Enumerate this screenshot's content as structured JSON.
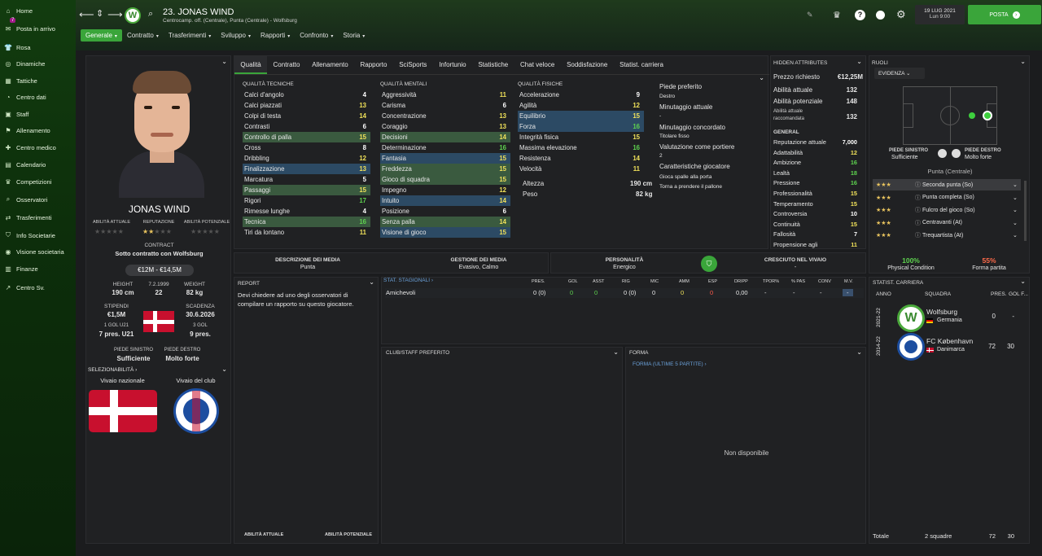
{
  "sidebar": {
    "badge": "7",
    "items": [
      {
        "label": "Home",
        "icon": "home-icon",
        "glyph": "⌂"
      },
      {
        "label": "Posta in arrivo",
        "icon": "inbox-icon",
        "glyph": "✉"
      },
      {
        "label": "Rosa",
        "icon": "squad-icon",
        "glyph": "👕"
      },
      {
        "label": "Dinamiche",
        "icon": "dynamics-icon",
        "glyph": "◎"
      },
      {
        "label": "Tattiche",
        "icon": "tactics-icon",
        "glyph": "▦"
      },
      {
        "label": "Centro dati",
        "icon": "data-icon",
        "glyph": "◔"
      },
      {
        "label": "Staff",
        "icon": "staff-icon",
        "glyph": "▣"
      },
      {
        "label": "Allenamento",
        "icon": "training-icon",
        "glyph": "⚑"
      },
      {
        "label": "Centro medico",
        "icon": "medical-icon",
        "glyph": "✚"
      },
      {
        "label": "Calendario",
        "icon": "calendar-icon",
        "glyph": "▤"
      },
      {
        "label": "Competizioni",
        "icon": "trophy-icon",
        "glyph": "♛"
      },
      {
        "label": "Osservatori",
        "icon": "scout-icon",
        "glyph": "⌕"
      },
      {
        "label": "Trasferimenti",
        "icon": "transfer-icon",
        "glyph": "⇄"
      },
      {
        "label": "Info Societarie",
        "icon": "club-info-icon",
        "glyph": "⛉"
      },
      {
        "label": "Visione societaria",
        "icon": "vision-icon",
        "glyph": "◉"
      },
      {
        "label": "Finanze",
        "icon": "finance-icon",
        "glyph": "▥"
      },
      {
        "label": "Centro Sv.",
        "icon": "dev-centre-icon",
        "glyph": "↗"
      }
    ]
  },
  "header": {
    "title": "23. JONAS WIND",
    "subtitle": "Centrocamp. off. (Centrale), Punta (Centrale) - Wolfsburg",
    "date": "19 LUG 2021",
    "time": "Lun 9:00",
    "posta": "POSTA"
  },
  "tabs": [
    "Generale",
    "Contratto",
    "Trasferimenti",
    "Sviluppo",
    "Rapporti",
    "Confronto",
    "Storia"
  ],
  "subtabs": [
    "Qualità",
    "Contratto",
    "Allenamento",
    "Rapporto",
    "SciSports",
    "Infortunio",
    "Statistiche",
    "Chat veloce",
    "Soddisfazione",
    "Statist. carriera"
  ],
  "profile": {
    "name": "JONAS WIND",
    "lbl_att": "ABILITÀ ATTUALE",
    "lbl_rep": "REPUTAZIONE",
    "lbl_pot": "ABILITÀ POTENZIALE",
    "contract_lbl": "CONTRACT",
    "contract": "Sotto contratto con Wolfsburg",
    "value": "€12M - €14,5M",
    "height_lbl": "HEIGHT",
    "height": "190 cm",
    "dob": "7.2.1999",
    "age": "22",
    "weight_lbl": "WEIGHT",
    "weight": "82 kg",
    "stip_lbl": "STIPENDI",
    "stip": "€1,5M",
    "scad_lbl": "SCADENZA",
    "scad": "30.6.2026",
    "u21_lbl": "1 GOL U21",
    "u21": "7 pres. U21",
    "caps_lbl": "3 GOL",
    "caps": "9 pres.",
    "foot_l_lbl": "PIEDE SINISTRO",
    "foot_l": "Sufficiente",
    "foot_r_lbl": "PIEDE DESTRO",
    "foot_r": "Molto forte",
    "sel_lbl": "SELEZIONABILITÀ",
    "nat_lbl": "Vivaio nazionale",
    "club_lbl": "Vivaio del club"
  },
  "tech": {
    "title": "QUALITÀ TECNICHE",
    "rows": [
      {
        "n": "Calci d'angolo",
        "v": "4",
        "c": "w",
        "h": ""
      },
      {
        "n": "Calci piazzati",
        "v": "13",
        "c": "y",
        "h": ""
      },
      {
        "n": "Colpi di testa",
        "v": "14",
        "c": "y",
        "h": ""
      },
      {
        "n": "Contrasti",
        "v": "6",
        "c": "w",
        "h": ""
      },
      {
        "n": "Controllo di palla",
        "v": "15",
        "c": "y",
        "h": "hl"
      },
      {
        "n": "Cross",
        "v": "8",
        "c": "w",
        "h": ""
      },
      {
        "n": "Dribbling",
        "v": "12",
        "c": "y",
        "h": ""
      },
      {
        "n": "Finalizzazione",
        "v": "13",
        "c": "y",
        "h": "bl"
      },
      {
        "n": "Marcatura",
        "v": "5",
        "c": "w",
        "h": ""
      },
      {
        "n": "Passaggi",
        "v": "15",
        "c": "y",
        "h": "hl"
      },
      {
        "n": "Rigori",
        "v": "17",
        "c": "g",
        "h": ""
      },
      {
        "n": "Rimesse lunghe",
        "v": "4",
        "c": "w",
        "h": ""
      },
      {
        "n": "Tecnica",
        "v": "16",
        "c": "g",
        "h": "hl"
      },
      {
        "n": "Tiri da lontano",
        "v": "11",
        "c": "y",
        "h": ""
      }
    ]
  },
  "mental": {
    "title": "QUALITÀ MENTALI",
    "rows": [
      {
        "n": "Aggressività",
        "v": "11",
        "c": "y",
        "h": ""
      },
      {
        "n": "Carisma",
        "v": "6",
        "c": "w",
        "h": ""
      },
      {
        "n": "Concentrazione",
        "v": "13",
        "c": "y",
        "h": ""
      },
      {
        "n": "Coraggio",
        "v": "13",
        "c": "y",
        "h": ""
      },
      {
        "n": "Decisioni",
        "v": "14",
        "c": "y",
        "h": "hl"
      },
      {
        "n": "Determinazione",
        "v": "16",
        "c": "g",
        "h": ""
      },
      {
        "n": "Fantasia",
        "v": "15",
        "c": "y",
        "h": "bl"
      },
      {
        "n": "Freddezza",
        "v": "15",
        "c": "y",
        "h": "hl"
      },
      {
        "n": "Gioco di squadra",
        "v": "15",
        "c": "y",
        "h": "hl"
      },
      {
        "n": "Impegno",
        "v": "12",
        "c": "y",
        "h": ""
      },
      {
        "n": "Intuito",
        "v": "14",
        "c": "y",
        "h": "bl"
      },
      {
        "n": "Posizione",
        "v": "6",
        "c": "w",
        "h": ""
      },
      {
        "n": "Senza palla",
        "v": "14",
        "c": "y",
        "h": "hl"
      },
      {
        "n": "Visione di gioco",
        "v": "15",
        "c": "y",
        "h": "bl"
      }
    ]
  },
  "phys": {
    "title": "QUALITÀ FISICHE",
    "rows": [
      {
        "n": "Accelerazione",
        "v": "9",
        "c": "w",
        "h": ""
      },
      {
        "n": "Agilità",
        "v": "12",
        "c": "y",
        "h": ""
      },
      {
        "n": "Equilibrio",
        "v": "15",
        "c": "y",
        "h": "bl"
      },
      {
        "n": "Forza",
        "v": "16",
        "c": "g",
        "h": "bl"
      },
      {
        "n": "Integrità fisica",
        "v": "15",
        "c": "y",
        "h": ""
      },
      {
        "n": "Massima elevazione",
        "v": "16",
        "c": "g",
        "h": ""
      },
      {
        "n": "Resistenza",
        "v": "14",
        "c": "y",
        "h": ""
      },
      {
        "n": "Velocità",
        "v": "11",
        "c": "y",
        "h": ""
      }
    ],
    "alt_lbl": "Altezza",
    "alt": "190 cm",
    "peso_lbl": "Peso",
    "peso": "82 kg"
  },
  "info": {
    "foot_lbl": "Piede preferito",
    "foot": "Destro",
    "min_lbl": "Minutaggio attuale",
    "min": "-",
    "agreed_lbl": "Minutaggio concordato",
    "agreed": "Titolare fisso",
    "gk_lbl": "Valutazione come portiere",
    "gk": "2",
    "traits_lbl": "Caratteristiche giocatore",
    "t1": "Gioca spalle alla porta",
    "t2": "Torna a prendere il pallone"
  },
  "hidden": {
    "title": "HIDDEN ATTRIBUTES",
    "prezzo_lbl": "Prezzo richiesto",
    "prezzo": "€12,25M",
    "att_lbl": "Abilità attuale",
    "att": "132",
    "pot_lbl": "Abilità potenziale",
    "pot": "148",
    "rac_lbl1": "Abilità attuale",
    "rac_lbl2": "raccomandata",
    "rac": "132",
    "gen_lbl": "GENERAL",
    "rows": [
      {
        "n": "Reputazione attuale",
        "v": "7,000",
        "c": "w"
      },
      {
        "n": "Adattabilità",
        "v": "12",
        "c": "y"
      },
      {
        "n": "Ambizione",
        "v": "16",
        "c": "g"
      },
      {
        "n": "Lealtà",
        "v": "18",
        "c": "g"
      },
      {
        "n": "Pressione",
        "v": "16",
        "c": "g"
      },
      {
        "n": "Professionalità",
        "v": "15",
        "c": "y"
      },
      {
        "n": "Temperamento",
        "v": "15",
        "c": "y"
      },
      {
        "n": "Controversia",
        "v": "10",
        "c": "w"
      },
      {
        "n": "Continuità",
        "v": "15",
        "c": "y"
      },
      {
        "n": "Fallosità",
        "v": "7",
        "c": "w"
      },
      {
        "n": "Propensione agli",
        "v": "11",
        "c": "y"
      }
    ]
  },
  "roles": {
    "title": "RUOLI",
    "evid": "EVIDENZA",
    "fl_lbl": "PIEDE SINISTRO",
    "fl": "Sufficiente",
    "fr_lbl": "PIEDE DESTRO",
    "fr": "Molto forte",
    "pos": "Punta (Centrale)",
    "list": [
      {
        "n": "Seconda punta (So)",
        "stars": "★★★"
      },
      {
        "n": "Punta completa (So)",
        "stars": "★★★"
      },
      {
        "n": "Fulcro del gioco (So)",
        "stars": "★★★"
      },
      {
        "n": "Centravanti (At)",
        "stars": "★★★"
      },
      {
        "n": "Trequartista (At)",
        "stars": "★★★"
      }
    ],
    "cond": "100%",
    "cond_lbl": "Physical Condition",
    "form": "55%",
    "form_lbl": "Forma partita"
  },
  "media": {
    "d_lbl": "DESCRIZIONE DEI MEDIA",
    "d": "Punta",
    "g_lbl": "GESTIONE DEI MEDIA",
    "g": "Evasivo, Calmo",
    "p_lbl": "PERSONALITÀ",
    "p": "Energico",
    "c_lbl": "CRESCIUTO NEL VIVAIO",
    "c": "-"
  },
  "report": {
    "title": "REPORT",
    "text": "Devi chiedere ad uno degli osservatori di compilare un rapporto su questo giocatore.",
    "att": "ABILITÀ ATTUALE",
    "pot": "ABILITÀ POTENZIALE"
  },
  "stats": {
    "title": "STAT. STAGIONALI",
    "cols": [
      "PRES.",
      "GOL",
      "ASST",
      "RIG",
      "MIC",
      "AMM",
      "ESP",
      "DRIPP",
      "TPOR%",
      "% PAS",
      "CONV",
      "M.V."
    ],
    "row_name": "Amichevoli",
    "vals": [
      "0 (0)",
      "0",
      "0",
      "0 (0)",
      "0",
      "0",
      "0",
      "0,00",
      "-",
      "-",
      "-",
      "-"
    ]
  },
  "club": {
    "title": "CLUB/STAFF PREFERITO"
  },
  "forma": {
    "title": "FORMA",
    "sub": "FORMA (ULTIME 5 PARTITE)",
    "na": "Non disponibile"
  },
  "career": {
    "title": "STATIST. CARRIERA",
    "anno": "ANNO",
    "squadra": "SQUADRA",
    "pres": "PRES.",
    "gol": "GOL F...",
    "rows": [
      {
        "yr": "2021-22",
        "team": "Wolfsburg",
        "nat": "Germania",
        "p": "0",
        "g": "-"
      },
      {
        "yr": "2014-22",
        "team": "FC København",
        "nat": "Danimarca",
        "p": "72",
        "g": "30"
      }
    ],
    "tot_lbl": "Totale",
    "tot_teams": "2 squadre",
    "tot_p": "72",
    "tot_g": "30"
  },
  "colors": {
    "accent": "#3aa53a",
    "green_text": "#5ed34f",
    "yellow_text": "#f1e25a",
    "highlight_green": "#3a5a3f",
    "highlight_blue": "#2c4a64"
  }
}
